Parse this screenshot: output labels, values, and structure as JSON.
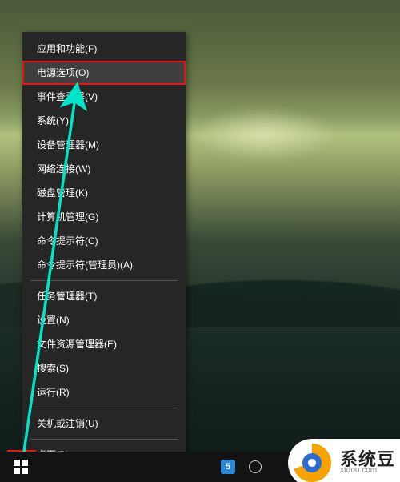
{
  "menu": {
    "items": [
      {
        "label": "应用和功能(F)"
      },
      {
        "label": "电源选项(O)",
        "highlighted": true
      },
      {
        "label": "事件查看器(V)"
      },
      {
        "label": "系统(Y)"
      },
      {
        "label": "设备管理器(M)"
      },
      {
        "label": "网络连接(W)"
      },
      {
        "label": "磁盘管理(K)"
      },
      {
        "label": "计算机管理(G)"
      },
      {
        "label": "命令提示符(C)"
      },
      {
        "label": "命令提示符(管理员)(A)"
      },
      {
        "label": "任务管理器(T)"
      },
      {
        "label": "设置(N)"
      },
      {
        "label": "文件资源管理器(E)"
      },
      {
        "label": "搜索(S)"
      },
      {
        "label": "运行(R)"
      },
      {
        "label": "关机或注销(U)"
      },
      {
        "label": "桌面(D)"
      }
    ]
  },
  "taskbar": {
    "tray": {
      "blue_label": "5"
    }
  },
  "annotation": {
    "highlight_color": "#ee1111",
    "arrow_color": "#00e5c7"
  },
  "watermark": {
    "text": "系统豆",
    "sub": "xtdou.com"
  }
}
